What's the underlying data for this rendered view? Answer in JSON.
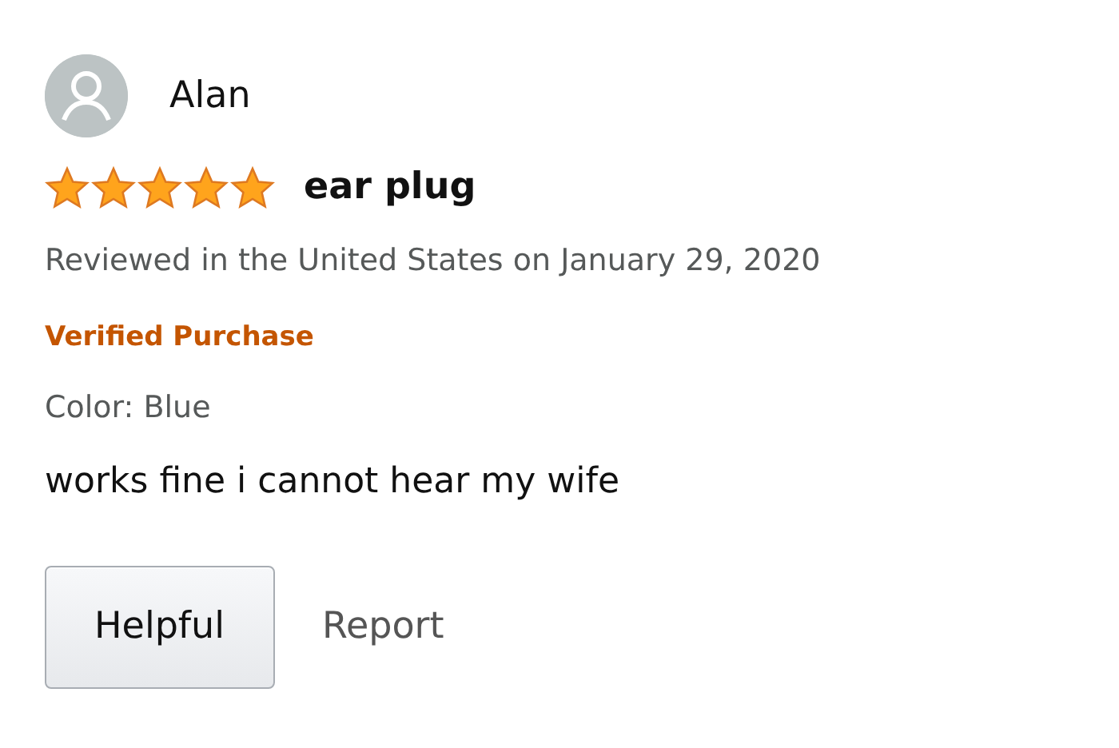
{
  "review": {
    "reviewer": "Alan",
    "stars": 5,
    "title": "ear plug",
    "meta": "Reviewed in the United States on January 29, 2020",
    "badge": "Verified Purchase",
    "variant": "Color: Blue",
    "body": "works fine i cannot hear my wife"
  },
  "actions": [
    {
      "kind": "button",
      "label": "Helpful"
    },
    {
      "kind": "link",
      "label": "Report"
    }
  ]
}
